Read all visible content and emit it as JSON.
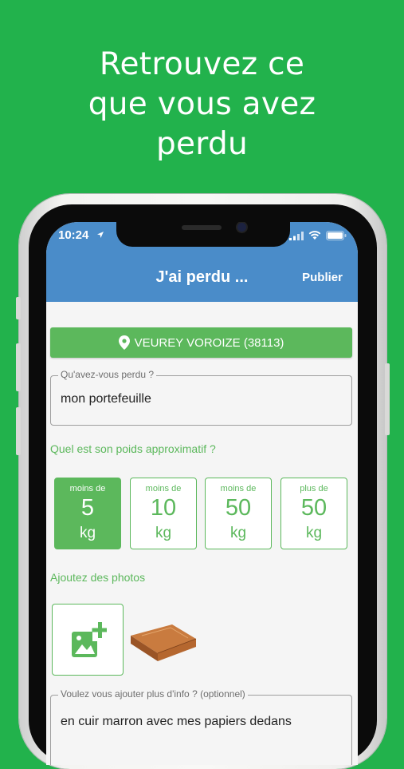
{
  "promo": {
    "headline_lines": [
      "Retrouvez ce",
      "que vous avez",
      "perdu"
    ]
  },
  "status_bar": {
    "time": "10:24"
  },
  "app_bar": {
    "title": "J'ai perdu ...",
    "publish_label": "Publier"
  },
  "location": {
    "label": "VEUREY VOROIZE (38113)",
    "icon": "map-pin-icon"
  },
  "form": {
    "lost_item": {
      "label": "Qu'avez-vous perdu ?",
      "value": "mon portefeuille"
    },
    "weight_question": "Quel est son poids approximatif ?",
    "weights": [
      {
        "prefix": "moins de",
        "value": "5",
        "unit": "kg",
        "selected": true
      },
      {
        "prefix": "moins de",
        "value": "10",
        "unit": "kg",
        "selected": false
      },
      {
        "prefix": "moins de",
        "value": "50",
        "unit": "kg",
        "selected": false
      },
      {
        "prefix": "plus de",
        "value": "50",
        "unit": "kg",
        "selected": false
      }
    ],
    "photos_label": "Ajoutez des photos",
    "more_info": {
      "label": "Voulez vous ajouter plus d'info ? (optionnel)",
      "value": "en cuir marron avec mes papiers dedans"
    }
  },
  "colors": {
    "background": "#22b24c",
    "app_bar": "#4a8cc9",
    "accent_green": "#5cb85c"
  }
}
